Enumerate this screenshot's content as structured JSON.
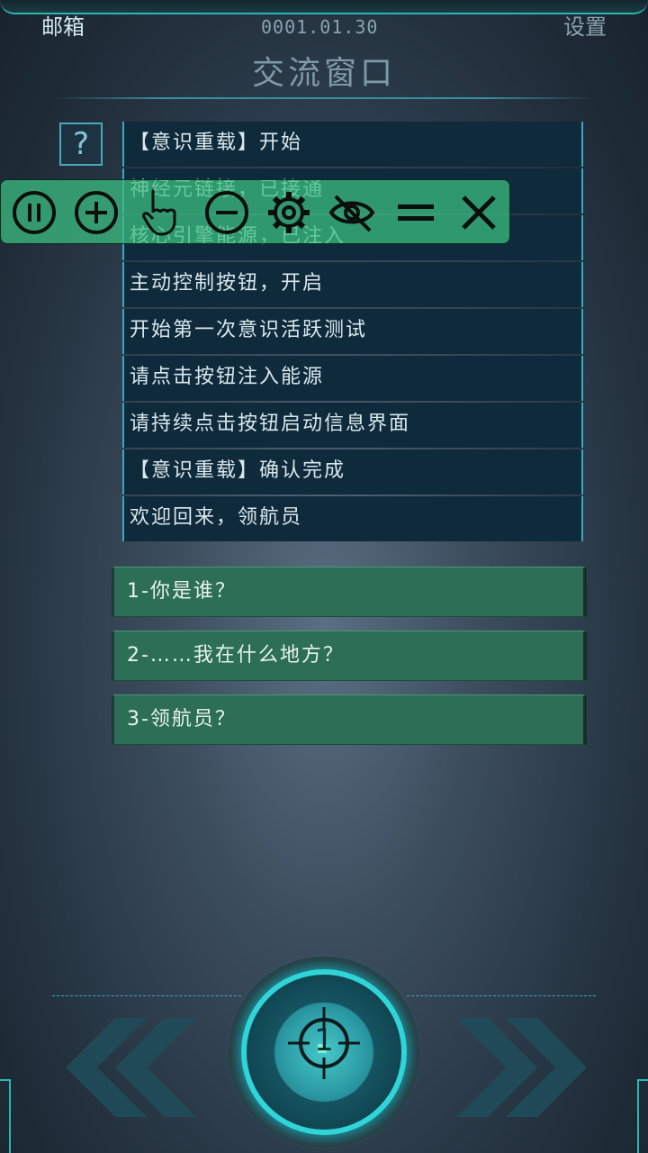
{
  "header": {
    "left_label": "邮箱",
    "date": "0001.01.30",
    "right_label": "设置",
    "title": "交流窗口"
  },
  "help_icon_glyph": "?",
  "log_messages": [
    "【意识重载】开始",
    "神经元链接，已接通",
    "核心引擎能源，已注入",
    "主动控制按钮，开启",
    "开始第一次意识活跃测试",
    "请点击按钮注入能源",
    "请持续点击按钮启动信息界面",
    "【意识重载】确认完成",
    "欢迎回来，领航员"
  ],
  "options": [
    "1-你是谁？",
    "2-……我在什么地方？",
    "3-领航员？"
  ],
  "toolbar_icons": [
    "pause-icon",
    "plus-icon",
    "hand-pointer-icon",
    "minus-icon",
    "gear-icon",
    "eye-slash-icon",
    "equals-icon",
    "close-icon"
  ],
  "core_button": {
    "number": "1"
  },
  "colors": {
    "accent": "#2fd5d8",
    "option_bg": "#2d6e56",
    "log_bg": "#0f2a3b",
    "toolbar_bg": "#3cbe82"
  }
}
